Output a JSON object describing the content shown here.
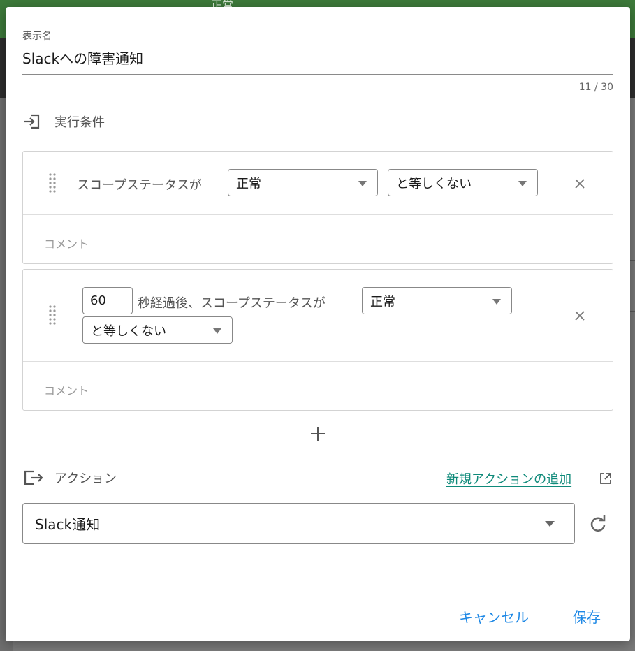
{
  "background": {
    "status_text": "正常"
  },
  "dialog": {
    "display_name_label": "表示名",
    "display_name_value": "Slackへの障害通知",
    "char_counter": "11 / 30",
    "conditions_title": "実行条件",
    "conditions": [
      {
        "prefix_text": "スコープステータスが",
        "status_select": "正常",
        "operator_select": "と等しくない",
        "comment_placeholder": "コメント"
      },
      {
        "seconds_value": "60",
        "prefix_text": "秒経過後、スコープステータスが",
        "status_select": "正常",
        "operator_select": "と等しくない",
        "comment_placeholder": "コメント"
      }
    ],
    "actions_title": "アクション",
    "new_action_link": "新規アクションの追加",
    "action_select": "Slack通知",
    "cancel_label": "キャンセル",
    "save_label": "保存"
  },
  "colors": {
    "accent": "#1e88e5",
    "link": "#0f8a7a",
    "header_green": "#3d7a3a"
  },
  "icons": {
    "conditions": "login-icon",
    "actions": "logout-icon",
    "drag": "drag-handle-icon",
    "remove": "close-icon",
    "add": "plus-icon",
    "external": "open-in-new-icon",
    "reload": "refresh-icon"
  }
}
